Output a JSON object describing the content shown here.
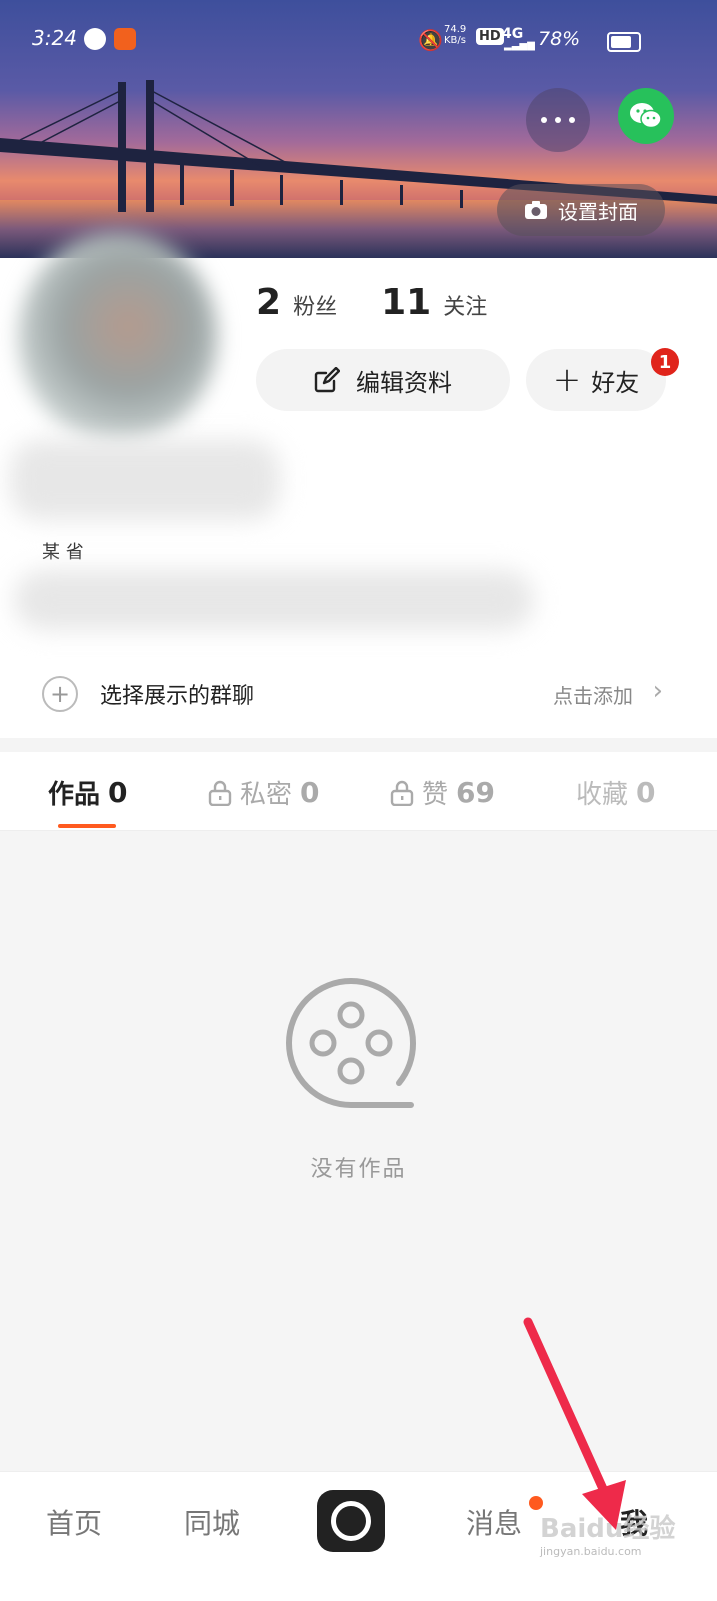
{
  "status_bar": {
    "time": "3:24",
    "net_speed": "74.9 KB/s",
    "hd": "HD",
    "network": "4G",
    "battery": "78%"
  },
  "cover": {
    "set_cover_label": "设置封面"
  },
  "profile": {
    "followers_count": "2",
    "followers_label": "粉丝",
    "following_count": "11",
    "following_label": "关注",
    "edit_profile_label": "编辑资料",
    "add_friend_label": "好友",
    "add_friend_badge": "1",
    "region": "某 省"
  },
  "group_chat": {
    "label": "选择展示的群聊",
    "action": "点击添加"
  },
  "tabs": [
    {
      "label": "作品",
      "count": "0"
    },
    {
      "label": "私密",
      "count": "0"
    },
    {
      "label": "赞",
      "count": "69"
    },
    {
      "label": "收藏",
      "count": "0"
    }
  ],
  "empty_state": {
    "text": "没有作品"
  },
  "bottom_nav": {
    "home": "首页",
    "nearby": "同城",
    "messages": "消息",
    "me": "我"
  },
  "watermark": {
    "brand": "Baidu经验",
    "url": "jingyan.baidu.com"
  },
  "colors": {
    "accent": "#ff5a1f",
    "wechat": "#27c15b",
    "badge": "#e0241b",
    "arrow": "#ee2a4a"
  }
}
